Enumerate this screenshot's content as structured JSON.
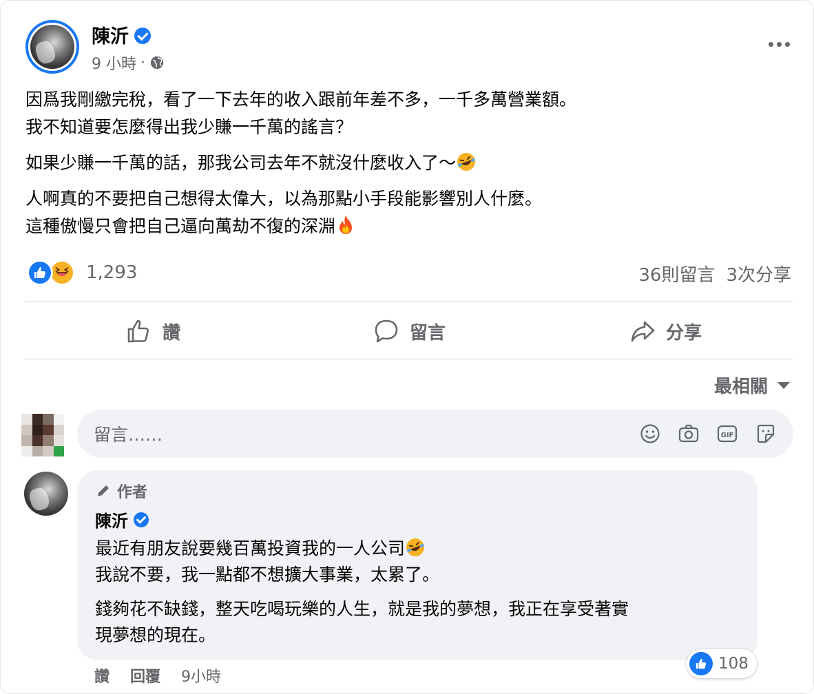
{
  "post": {
    "author": "陳沂",
    "time": "9 小時",
    "dot": "·",
    "body": [
      [
        "因爲我剛繳完稅，看了一下去年的收入跟前年差不多，一千多萬營業額。",
        "我不知道要怎麼得出我少賺一千萬的謠言？"
      ],
      [
        "如果少賺一千萬的話，那我公司去年不就沒什麼收入了～"
      ],
      [
        "人啊真的不要把自己想得太偉大，以為那點小手段能影響別人什麼。",
        "這種傲慢只會把自己逼向萬劫不復的深淵"
      ]
    ],
    "reactions_count": "1,293",
    "comments_count": "36則留言",
    "shares_count": "3次分享"
  },
  "actions": {
    "like": "讚",
    "comment": "留言",
    "share": "分享"
  },
  "sort": {
    "label": "最相關"
  },
  "comment_input": {
    "placeholder": "留言……"
  },
  "comment": {
    "badge": "作者",
    "author": "陳沂",
    "lines_p1": [
      "最近有朋友說要幾百萬投資我的一人公司",
      "我說不要，我一點都不想擴大事業，太累了。"
    ],
    "lines_p2": [
      "錢夠花不缺錢，整天吃喝玩樂的人生，就是我的夢想，我正在享受著實",
      "現夢想的現在。"
    ],
    "likes": "108",
    "like_action": "讚",
    "reply_action": "回覆",
    "time": "9小時"
  },
  "colors": {
    "accent": "#1877f2",
    "secondary_text": "#65676b",
    "bubble": "#f0f2f5"
  }
}
